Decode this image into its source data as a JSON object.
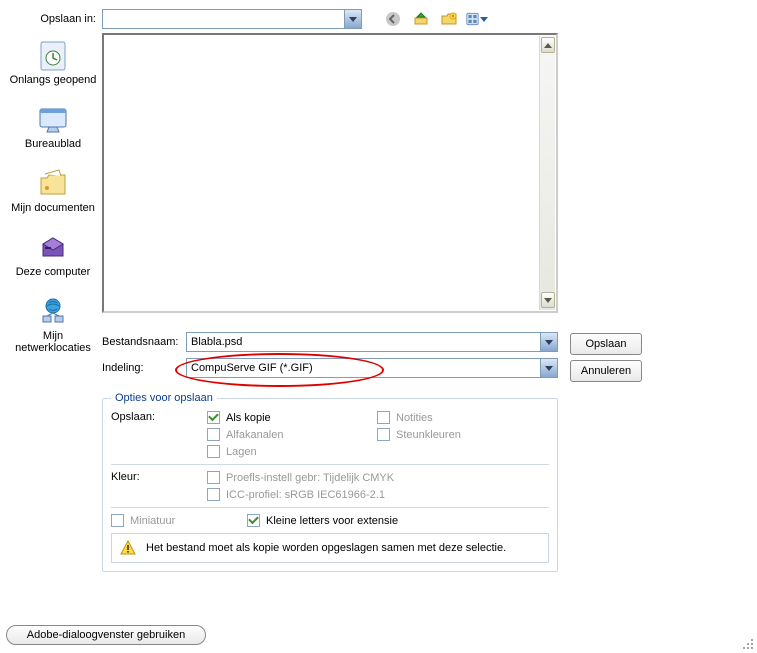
{
  "top": {
    "save_in_label": "Opslaan in:",
    "location_value": "",
    "icons": [
      "back-icon",
      "up-icon",
      "new-folder-icon",
      "views-icon"
    ]
  },
  "sidebar": {
    "items": [
      {
        "label": "Onlangs geopend"
      },
      {
        "label": "Bureaublad"
      },
      {
        "label": "Mijn documenten"
      },
      {
        "label": "Deze computer"
      },
      {
        "label": "Mijn netwerklocaties"
      }
    ]
  },
  "fields": {
    "filename_label": "Bestandsnaam:",
    "filename_value": "Blabla.psd",
    "format_label": "Indeling:",
    "format_value": "CompuServe GIF (*.GIF)"
  },
  "buttons": {
    "save": "Opslaan",
    "cancel": "Annuleren",
    "adobe": "Adobe-dialoogvenster gebruiken"
  },
  "options": {
    "legend": "Opties voor opslaan",
    "save_label": "Opslaan:",
    "col_left": [
      {
        "label": "Als kopie",
        "checked": true,
        "disabled": false
      },
      {
        "label": "Alfakanalen",
        "checked": false,
        "disabled": true
      },
      {
        "label": "Lagen",
        "checked": false,
        "disabled": true
      }
    ],
    "col_right": [
      {
        "label": "Notities",
        "checked": false,
        "disabled": true
      },
      {
        "label": "Steunkleuren",
        "checked": false,
        "disabled": true
      }
    ],
    "color_label": "Kleur:",
    "color_rows": [
      {
        "label": "Proefls-instell gebr: Tijdelijk CMYK",
        "checked": false,
        "disabled": true
      },
      {
        "label": "ICC-profiel: sRGB IEC61966-2.1",
        "checked": false,
        "disabled": true
      }
    ],
    "thumbnail": {
      "label": "Miniatuur",
      "checked": false,
      "disabled": true
    },
    "lowercase": {
      "label": "Kleine letters voor extensie",
      "checked": true,
      "disabled": false
    },
    "warning": "Het bestand moet als kopie worden opgeslagen samen met deze selectie."
  }
}
